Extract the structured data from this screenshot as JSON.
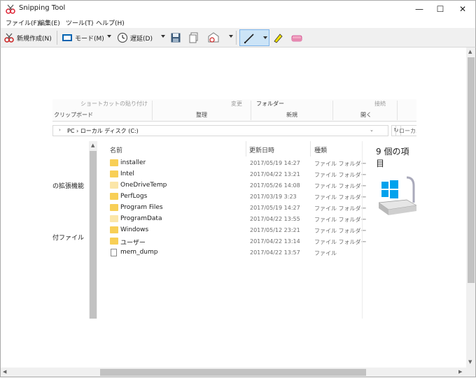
{
  "window": {
    "title": "Snipping Tool",
    "controls": {
      "minimize": "—",
      "maximize": "☐",
      "close": "✕"
    }
  },
  "menu": {
    "items": [
      "ファイル(F)",
      "編集(E)",
      "ツール(T)",
      "ヘルプ(H)"
    ]
  },
  "toolbar": {
    "new_label": "新規作成(N)",
    "mode_label": "モード(M)",
    "delay_label": "遅延(D)",
    "icons": [
      "scissors-icon",
      "mode-icon",
      "clock-icon",
      "save-icon",
      "copy-icon",
      "send-icon",
      "pen-icon",
      "highlighter-icon",
      "eraser-icon"
    ]
  },
  "snip": {
    "ribbon": {
      "faint_items": [
        "ショートカットの貼り付け",
        "変更",
        "フォルダー",
        "新規",
        "接続"
      ],
      "groups": [
        "クリップボード",
        "整理",
        "新規",
        "開く"
      ]
    },
    "address": {
      "path": "PC  ›  ローカル ディスク (C:)",
      "search_placeholder": "ローカル",
      "refresh": "↻"
    },
    "nav": [
      "の拡張機能",
      "付ファイル"
    ],
    "columns": {
      "name": "名前",
      "date": "更新日時",
      "type": "種類"
    },
    "rows": [
      {
        "name": "installer",
        "date": "2017/05/19 14:27",
        "type": "ファイル フォルダー",
        "kind": "folder"
      },
      {
        "name": "Intel",
        "date": "2017/04/22 13:21",
        "type": "ファイル フォルダー",
        "kind": "folder"
      },
      {
        "name": "OneDriveTemp",
        "date": "2017/05/26 14:08",
        "type": "ファイル フォルダー",
        "kind": "folder-light"
      },
      {
        "name": "PerfLogs",
        "date": "2017/03/19 3:23",
        "type": "ファイル フォルダー",
        "kind": "folder"
      },
      {
        "name": "Program Files",
        "date": "2017/05/19 14:27",
        "type": "ファイル フォルダー",
        "kind": "folder"
      },
      {
        "name": "ProgramData",
        "date": "2017/04/22 13:55",
        "type": "ファイル フォルダー",
        "kind": "folder-light"
      },
      {
        "name": "Windows",
        "date": "2017/05/12 23:21",
        "type": "ファイル フォルダー",
        "kind": "folder"
      },
      {
        "name": "ユーザー",
        "date": "2017/04/22 13:14",
        "type": "ファイル フォルダー",
        "kind": "folder"
      },
      {
        "name": "mem_dump",
        "date": "2017/04/22 13:57",
        "type": "ファイル",
        "kind": "file"
      }
    ],
    "item_count": "9 個の項目"
  },
  "colors": {
    "folder": "#f8cf56",
    "folder_light": "#fbe6a8",
    "accent": "#0078d7",
    "selected": "#cce4f7"
  }
}
